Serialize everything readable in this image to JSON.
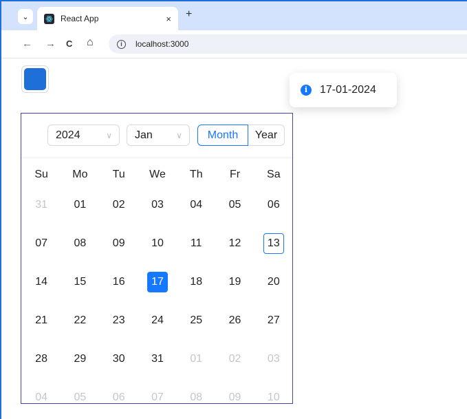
{
  "browser": {
    "tab_title": "React App",
    "tab_close": "×",
    "new_tab": "+",
    "url": "localhost:3000",
    "nav": {
      "back": "←",
      "forward": "→",
      "reload": "C",
      "home": "⌂"
    },
    "menu": "⌄"
  },
  "toast": {
    "icon": "i",
    "text": "17-01-2024"
  },
  "calendar": {
    "year": "2024",
    "month": "Jan",
    "mode_month": "Month",
    "mode_year": "Year",
    "weekdays": [
      "Su",
      "Mo",
      "Tu",
      "We",
      "Th",
      "Fr",
      "Sa"
    ],
    "weeks": [
      [
        {
          "d": "31",
          "out": true
        },
        {
          "d": "01"
        },
        {
          "d": "02"
        },
        {
          "d": "03"
        },
        {
          "d": "04"
        },
        {
          "d": "05"
        },
        {
          "d": "06"
        }
      ],
      [
        {
          "d": "07"
        },
        {
          "d": "08"
        },
        {
          "d": "09"
        },
        {
          "d": "10"
        },
        {
          "d": "11"
        },
        {
          "d": "12"
        },
        {
          "d": "13",
          "today": true
        }
      ],
      [
        {
          "d": "14"
        },
        {
          "d": "15"
        },
        {
          "d": "16"
        },
        {
          "d": "17",
          "selected": true
        },
        {
          "d": "18"
        },
        {
          "d": "19"
        },
        {
          "d": "20"
        }
      ],
      [
        {
          "d": "21"
        },
        {
          "d": "22"
        },
        {
          "d": "23"
        },
        {
          "d": "24"
        },
        {
          "d": "25"
        },
        {
          "d": "26"
        },
        {
          "d": "27"
        }
      ],
      [
        {
          "d": "28"
        },
        {
          "d": "29"
        },
        {
          "d": "30"
        },
        {
          "d": "31"
        },
        {
          "d": "01",
          "out": true
        },
        {
          "d": "02",
          "out": true
        },
        {
          "d": "03",
          "out": true
        }
      ],
      [
        {
          "d": "04",
          "out": true
        },
        {
          "d": "05",
          "out": true
        },
        {
          "d": "06",
          "out": true
        },
        {
          "d": "07",
          "out": true
        },
        {
          "d": "08",
          "out": true
        },
        {
          "d": "09",
          "out": true
        },
        {
          "d": "10",
          "out": true
        }
      ]
    ]
  },
  "colors": {
    "accent": "#1677ff",
    "toggle": "#1e70d8",
    "calendar_border": "#3c43a9"
  }
}
